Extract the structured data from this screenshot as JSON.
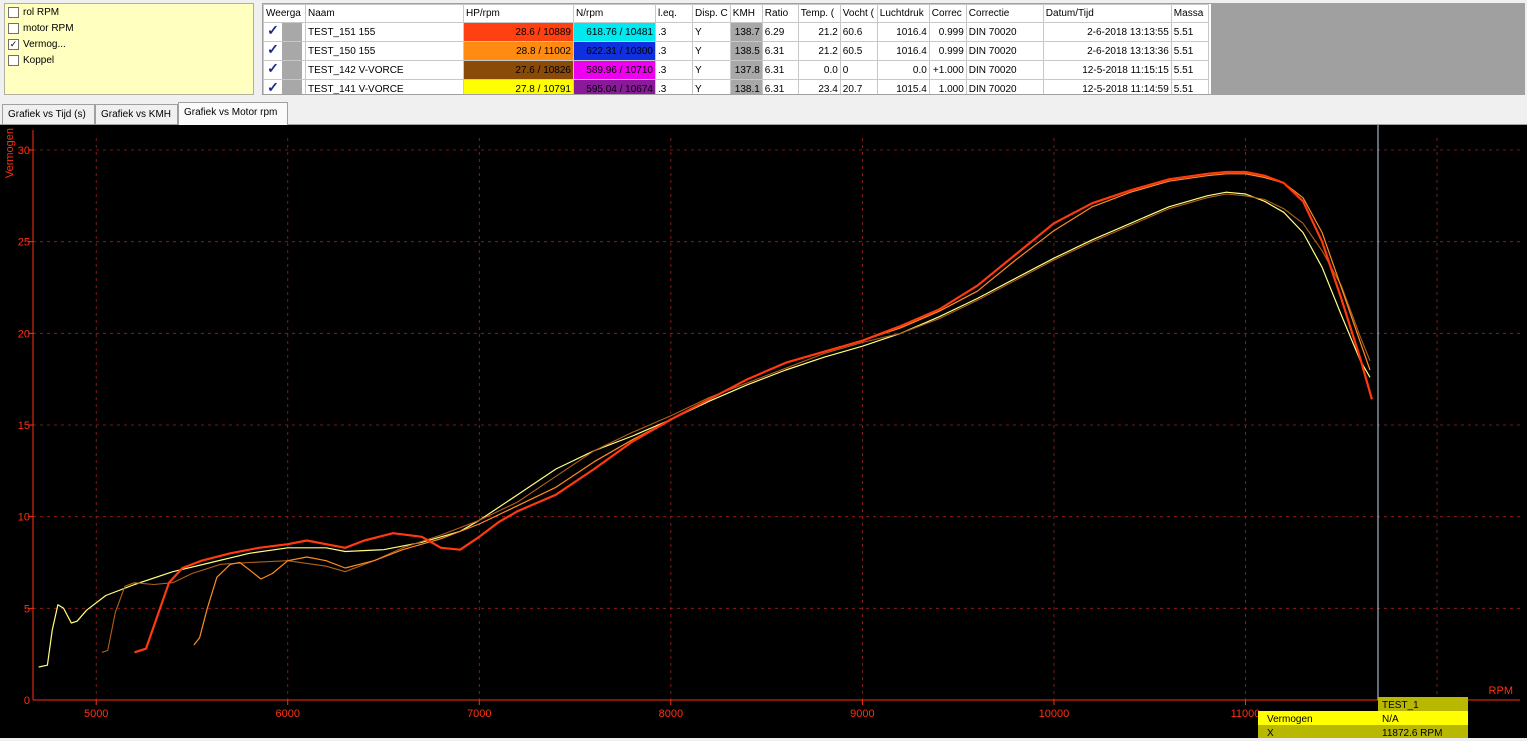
{
  "checklist": {
    "items": [
      {
        "label": "rol RPM",
        "checked": false
      },
      {
        "label": "motor RPM",
        "checked": false
      },
      {
        "label": "Vermog...",
        "checked": true
      },
      {
        "label": "Koppel",
        "checked": false
      }
    ],
    "check_glyph": "✓"
  },
  "table": {
    "headers": [
      "Weerga",
      "Naam",
      "HP/rpm",
      "N/rpm",
      "l.eq.",
      "Disp. C",
      "KMH",
      "Ratio",
      "Temp. (",
      "Vocht (",
      "Luchtdruk",
      "Correc",
      "Correctie",
      "Datum/Tijd",
      "Massa"
    ],
    "rows": [
      {
        "naam": "TEST_151 155",
        "hp": "28.6 / 10889",
        "hp_color": "#ff4010",
        "n": "618.76 / 10481",
        "n_color": "#00e8f0",
        "leq": ".3",
        "disp": "Y",
        "kmh": "138.7",
        "ratio": "6.29",
        "temp": "21.2",
        "vocht": "60.6",
        "luchtdruk": "1016.4",
        "correc": "0.999",
        "correctie": "DIN 70020",
        "datum": "2-6-2018 13:13:55",
        "massa": "5.51"
      },
      {
        "naam": "TEST_150 155",
        "hp": "28.8 / 11002",
        "hp_color": "#ff8c10",
        "n": "622.31 / 10300",
        "n_color": "#1030e0",
        "leq": ".3",
        "disp": "Y",
        "kmh": "138.5",
        "ratio": "6.31",
        "temp": "21.2",
        "vocht": "60.5",
        "luchtdruk": "1016.4",
        "correc": "0.999",
        "correctie": "DIN 70020",
        "datum": "2-6-2018 13:13:36",
        "massa": "5.51"
      },
      {
        "naam": "TEST_142 V-VORCE",
        "hp": "27.6 / 10826",
        "hp_color": "#8a4a08",
        "n": "589.96 / 10710",
        "n_color": "#f000f0",
        "leq": ".3",
        "disp": "Y",
        "kmh": "137.8",
        "ratio": "6.31",
        "temp": "0.0",
        "vocht": "0",
        "luchtdruk": "0.0",
        "correc": "+1.000",
        "correctie": "DIN 70020",
        "datum": "12-5-2018 11:15:15",
        "massa": "5.51"
      },
      {
        "naam": "TEST_141 V-VORCE",
        "hp": "27.8 / 10791",
        "hp_color": "#ffff00",
        "n": "595.04 / 10674",
        "n_color": "#8a1a9a",
        "leq": ".3",
        "disp": "Y",
        "kmh": "138.1",
        "ratio": "6.31",
        "temp": "23.4",
        "vocht": "20.7",
        "luchtdruk": "1015.4",
        "correc": "1.000",
        "correctie": "DIN 70020",
        "datum": "12-5-2018 11:14:59",
        "massa": "5.51"
      }
    ]
  },
  "tabs": [
    "Grafiek vs Tijd (s)",
    "Grafiek vs KMH",
    "Grafiek vs Motor rpm"
  ],
  "active_tab": 2,
  "chart_data": {
    "type": "line",
    "ylabel": "Vermogen",
    "xlabel": "RPM",
    "xlim": [
      4670,
      11650
    ],
    "ylim": [
      0,
      30
    ],
    "x_ticks": [
      5000,
      6000,
      7000,
      8000,
      9000,
      10000,
      11000
    ],
    "y_ticks": [
      5,
      10,
      15,
      20,
      25,
      30
    ],
    "grid": true,
    "cursor_x": 11872.6,
    "series": [
      {
        "color": "#ffff80",
        "width": 1.2,
        "points": [
          [
            4700,
            1.8
          ],
          [
            4745,
            1.9
          ],
          [
            4770,
            3.8
          ],
          [
            4800,
            5.2
          ],
          [
            4830,
            5.0
          ],
          [
            4870,
            4.2
          ],
          [
            4900,
            4.3
          ],
          [
            4950,
            4.9
          ],
          [
            5050,
            5.7
          ],
          [
            5200,
            6.3
          ],
          [
            5400,
            7.0
          ],
          [
            5600,
            7.5
          ],
          [
            5800,
            8.0
          ],
          [
            6000,
            8.3
          ],
          [
            6200,
            8.3
          ],
          [
            6300,
            8.1
          ],
          [
            6500,
            8.2
          ],
          [
            6700,
            8.6
          ],
          [
            6900,
            9.2
          ],
          [
            7000,
            9.8
          ],
          [
            7200,
            11.2
          ],
          [
            7400,
            12.6
          ],
          [
            7600,
            13.6
          ],
          [
            7800,
            14.4
          ],
          [
            8000,
            15.3
          ],
          [
            8200,
            16.3
          ],
          [
            8400,
            17.2
          ],
          [
            8600,
            18.0
          ],
          [
            8800,
            18.7
          ],
          [
            9000,
            19.3
          ],
          [
            9200,
            20.0
          ],
          [
            9400,
            20.9
          ],
          [
            9600,
            21.9
          ],
          [
            9800,
            23.0
          ],
          [
            10000,
            24.1
          ],
          [
            10200,
            25.1
          ],
          [
            10400,
            26.0
          ],
          [
            10600,
            26.9
          ],
          [
            10800,
            27.5
          ],
          [
            10900,
            27.7
          ],
          [
            11000,
            27.6
          ],
          [
            11100,
            27.2
          ],
          [
            11200,
            26.6
          ],
          [
            11300,
            25.5
          ],
          [
            11400,
            23.6
          ],
          [
            11500,
            21.0
          ],
          [
            11600,
            18.5
          ],
          [
            11650,
            17.6
          ]
        ]
      },
      {
        "color": "#b06018",
        "width": 1.1,
        "points": [
          [
            5030,
            2.6
          ],
          [
            5060,
            2.7
          ],
          [
            5100,
            4.8
          ],
          [
            5150,
            6.2
          ],
          [
            5200,
            6.4
          ],
          [
            5300,
            6.3
          ],
          [
            5400,
            6.4
          ],
          [
            5500,
            6.9
          ],
          [
            5650,
            7.4
          ],
          [
            5800,
            7.5
          ],
          [
            6000,
            7.6
          ],
          [
            6200,
            7.3
          ],
          [
            6300,
            7.0
          ],
          [
            6450,
            7.6
          ],
          [
            6600,
            8.3
          ],
          [
            6800,
            9.0
          ],
          [
            7000,
            9.8
          ],
          [
            7200,
            10.8
          ],
          [
            7400,
            12.2
          ],
          [
            7600,
            13.6
          ],
          [
            7800,
            14.6
          ],
          [
            8000,
            15.5
          ],
          [
            8200,
            16.5
          ],
          [
            8400,
            17.3
          ],
          [
            8600,
            18.1
          ],
          [
            8800,
            18.9
          ],
          [
            9000,
            19.5
          ],
          [
            9200,
            20.0
          ],
          [
            9400,
            20.8
          ],
          [
            9600,
            21.8
          ],
          [
            9800,
            22.9
          ],
          [
            10000,
            24.0
          ],
          [
            10200,
            25.0
          ],
          [
            10400,
            25.9
          ],
          [
            10600,
            26.8
          ],
          [
            10800,
            27.4
          ],
          [
            10900,
            27.6
          ],
          [
            11000,
            27.5
          ],
          [
            11100,
            27.3
          ],
          [
            11200,
            26.8
          ],
          [
            11300,
            26.0
          ],
          [
            11400,
            24.5
          ],
          [
            11500,
            22.6
          ],
          [
            11600,
            19.8
          ],
          [
            11650,
            18.5
          ]
        ]
      },
      {
        "color": "#ff8c20",
        "width": 1.2,
        "points": [
          [
            5510,
            3.0
          ],
          [
            5540,
            3.4
          ],
          [
            5580,
            5.0
          ],
          [
            5630,
            6.7
          ],
          [
            5700,
            7.4
          ],
          [
            5750,
            7.5
          ],
          [
            5800,
            7.1
          ],
          [
            5860,
            6.6
          ],
          [
            5920,
            6.9
          ],
          [
            6000,
            7.6
          ],
          [
            6100,
            7.8
          ],
          [
            6200,
            7.6
          ],
          [
            6300,
            7.2
          ],
          [
            6450,
            7.6
          ],
          [
            6600,
            8.2
          ],
          [
            6800,
            8.8
          ],
          [
            7000,
            9.6
          ],
          [
            7200,
            10.6
          ],
          [
            7400,
            11.6
          ],
          [
            7600,
            13.0
          ],
          [
            7800,
            14.2
          ],
          [
            8000,
            15.3
          ],
          [
            8200,
            16.4
          ],
          [
            8400,
            17.5
          ],
          [
            8600,
            18.4
          ],
          [
            8800,
            19.0
          ],
          [
            9000,
            19.6
          ],
          [
            9200,
            20.3
          ],
          [
            9400,
            21.2
          ],
          [
            9600,
            22.3
          ],
          [
            9800,
            24.0
          ],
          [
            10000,
            25.6
          ],
          [
            10200,
            26.9
          ],
          [
            10400,
            27.7
          ],
          [
            10600,
            28.3
          ],
          [
            10800,
            28.6
          ],
          [
            10900,
            28.7
          ],
          [
            11000,
            28.7
          ],
          [
            11100,
            28.5
          ],
          [
            11200,
            28.2
          ],
          [
            11300,
            27.4
          ],
          [
            11400,
            25.5
          ],
          [
            11500,
            22.5
          ],
          [
            11600,
            19.5
          ],
          [
            11650,
            18.0
          ]
        ]
      },
      {
        "color": "#ff3a10",
        "width": 2.2,
        "points": [
          [
            5200,
            2.6
          ],
          [
            5260,
            2.8
          ],
          [
            5320,
            4.6
          ],
          [
            5380,
            6.4
          ],
          [
            5450,
            7.2
          ],
          [
            5550,
            7.6
          ],
          [
            5700,
            8.0
          ],
          [
            5850,
            8.3
          ],
          [
            6000,
            8.5
          ],
          [
            6100,
            8.7
          ],
          [
            6200,
            8.5
          ],
          [
            6300,
            8.3
          ],
          [
            6400,
            8.7
          ],
          [
            6550,
            9.1
          ],
          [
            6700,
            8.9
          ],
          [
            6800,
            8.3
          ],
          [
            6900,
            8.2
          ],
          [
            7000,
            8.9
          ],
          [
            7100,
            9.7
          ],
          [
            7200,
            10.3
          ],
          [
            7400,
            11.2
          ],
          [
            7600,
            12.6
          ],
          [
            7800,
            14.1
          ],
          [
            8000,
            15.3
          ],
          [
            8200,
            16.4
          ],
          [
            8400,
            17.5
          ],
          [
            8600,
            18.4
          ],
          [
            8800,
            19.0
          ],
          [
            9000,
            19.6
          ],
          [
            9200,
            20.4
          ],
          [
            9400,
            21.3
          ],
          [
            9600,
            22.6
          ],
          [
            9800,
            24.3
          ],
          [
            10000,
            26.0
          ],
          [
            10200,
            27.1
          ],
          [
            10400,
            27.8
          ],
          [
            10600,
            28.4
          ],
          [
            10800,
            28.7
          ],
          [
            10900,
            28.8
          ],
          [
            11000,
            28.8
          ],
          [
            11100,
            28.6
          ],
          [
            11200,
            28.2
          ],
          [
            11300,
            27.2
          ],
          [
            11400,
            25.0
          ],
          [
            11500,
            21.9
          ],
          [
            11600,
            18.6
          ],
          [
            11660,
            16.4
          ]
        ]
      }
    ]
  },
  "axis_text": {
    "ylabel": "Vermogen",
    "xlabel": "RPM"
  },
  "cursor_panel": {
    "test_label": "TEST_1",
    "row1_label": "Vermogen",
    "row1_value": "N/A",
    "row2_label": "X",
    "row2_value": "11872.6 RPM"
  },
  "colors": {
    "grid": "#a02020",
    "axis_text": "#ff3010",
    "panel": "#ffff00",
    "panel_dark": "#b8b800"
  }
}
